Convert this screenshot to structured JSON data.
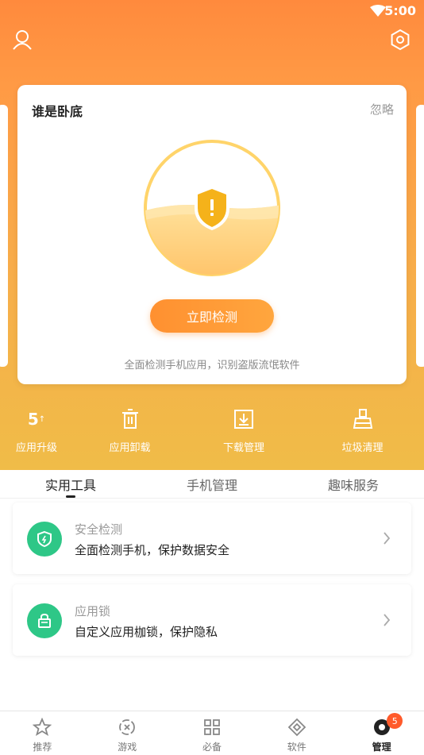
{
  "status_bar": {
    "time": "5:00"
  },
  "card": {
    "title": "谁是卧底",
    "ignore": "忽略",
    "button": "立即检测",
    "description": "全面检测手机应用，识别盗版流氓软件"
  },
  "tools": {
    "upgrade_count": "5",
    "upgrade_arrow": "↑",
    "items": [
      {
        "label": "应用升级",
        "icon": "upgrade-icon"
      },
      {
        "label": "应用卸载",
        "icon": "trash-icon"
      },
      {
        "label": "下载管理",
        "icon": "download-icon"
      },
      {
        "label": "垃圾清理",
        "icon": "broom-icon"
      }
    ]
  },
  "tabs": [
    {
      "label": "实用工具",
      "active": true
    },
    {
      "label": "手机管理",
      "active": false
    },
    {
      "label": "趣味服务",
      "active": false
    }
  ],
  "features": [
    {
      "title": "安全检测",
      "subtitle": "全面检测手机，保护数据安全",
      "icon": "shield-icon"
    },
    {
      "title": "应用锁",
      "subtitle": "自定义应用枷锁，保护隐私",
      "icon": "lock-icon"
    }
  ],
  "bottom_nav": [
    {
      "label": "推荐",
      "icon": "star-icon",
      "active": false
    },
    {
      "label": "游戏",
      "icon": "game-icon",
      "active": false
    },
    {
      "label": "必备",
      "icon": "grid-icon",
      "active": false
    },
    {
      "label": "软件",
      "icon": "software-icon",
      "active": false
    },
    {
      "label": "管理",
      "icon": "manage-icon",
      "active": true,
      "badge": "5"
    }
  ],
  "colors": {
    "accent": "#ff8a3d",
    "green": "#2ec787",
    "badge": "#ff5a2a"
  }
}
